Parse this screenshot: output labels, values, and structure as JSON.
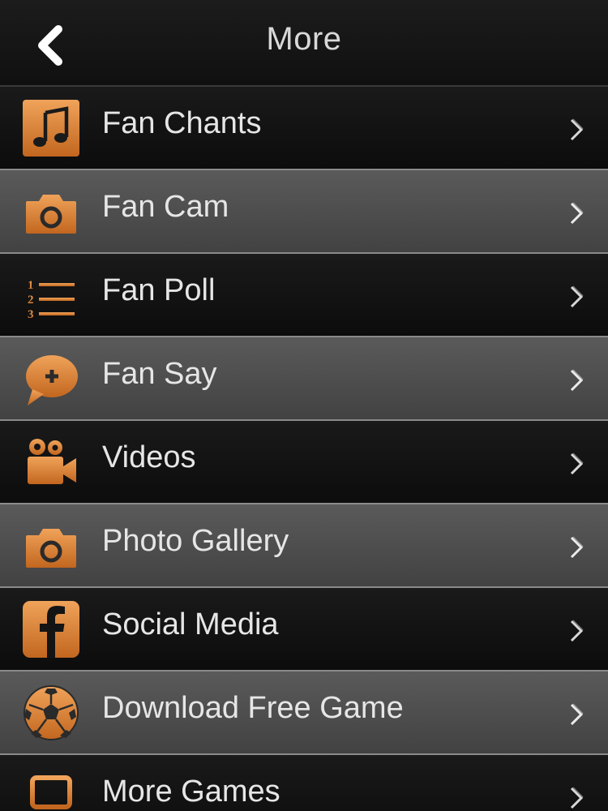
{
  "header": {
    "title": "More",
    "back_icon": "chevron-left-icon"
  },
  "colors": {
    "accent": "#e08a3a",
    "accent_dark": "#b85f1c",
    "text": "#e6e6e6",
    "row_dark": "#141414",
    "row_light": "#4e4e4e"
  },
  "menu": {
    "items": [
      {
        "label": "Fan Chants",
        "icon": "music-note-icon"
      },
      {
        "label": "Fan Cam",
        "icon": "camera-icon"
      },
      {
        "label": "Fan Poll",
        "icon": "numbered-list-icon"
      },
      {
        "label": "Fan Say",
        "icon": "speech-bubble-plus-icon"
      },
      {
        "label": "Videos",
        "icon": "video-camera-icon"
      },
      {
        "label": "Photo Gallery",
        "icon": "camera-icon"
      },
      {
        "label": "Social Media",
        "icon": "facebook-icon"
      },
      {
        "label": "Download Free Game",
        "icon": "soccer-ball-icon"
      },
      {
        "label": "More Games",
        "icon": "laptop-icon"
      }
    ]
  }
}
